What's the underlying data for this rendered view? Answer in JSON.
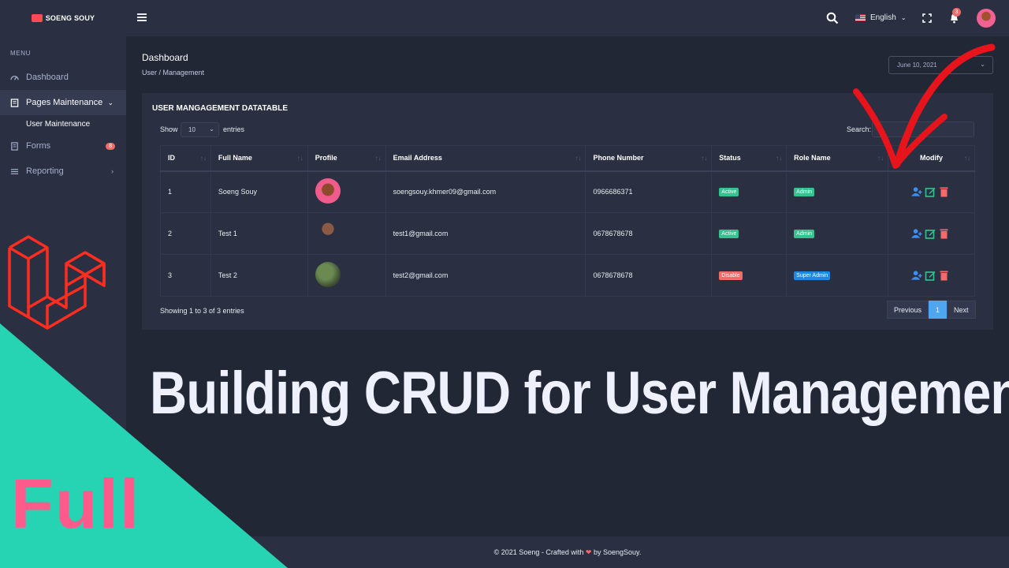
{
  "brand": {
    "name": "SOENG SOUY"
  },
  "sidebar": {
    "menu_title": "MENU",
    "items": [
      {
        "label": "Dashboard",
        "icon": "dashboard-icon"
      },
      {
        "label": "Pages Maintenance",
        "icon": "pages-icon",
        "active": true
      },
      {
        "label": "Forms",
        "icon": "forms-icon",
        "badge": "8"
      },
      {
        "label": "Reporting",
        "icon": "reporting-icon"
      }
    ],
    "submenu": {
      "label": "User Maintenance"
    }
  },
  "topbar": {
    "language": "English",
    "notification_count": "3"
  },
  "page": {
    "title": "Dashboard",
    "breadcrumb": "User / Management",
    "date_filter": "June 10, 2021"
  },
  "card": {
    "title": "USER MANGAGEMENT DATATABLE",
    "show_label": "Show",
    "show_value": "10",
    "entries_label": "entries",
    "search_label": "Search:",
    "columns": [
      "ID",
      "Full Name",
      "Profile",
      "Email Address",
      "Phone Number",
      "Status",
      "Role Name",
      "Modify"
    ],
    "rows": [
      {
        "id": "1",
        "name": "Soeng Souy",
        "email": "soengsouy.khmer09@gmail.com",
        "phone": "0966686371",
        "status": "Active",
        "role": "Admin"
      },
      {
        "id": "2",
        "name": "Test 1",
        "email": "test1@gmail.com",
        "phone": "0678678678",
        "status": "Active",
        "role": "Admin"
      },
      {
        "id": "3",
        "name": "Test 2",
        "email": "test2@gmail.com",
        "phone": "0678678678",
        "status": "Disable",
        "role": "Super Admin"
      }
    ],
    "showing": "Showing 1 to 3 of 3 entries",
    "pager": {
      "previous": "Previous",
      "page": "1",
      "next": "Next"
    }
  },
  "headline": "Building CRUD for User Management",
  "badge_text": "Full",
  "footer": {
    "prefix": "© 2021 Soeng - Crafted with",
    "suffix": "by SoengSouy."
  },
  "colors": {
    "accent_teal": "#26d4b4",
    "full_pink": "#ff5a8c",
    "laravel_red": "#ff2d20",
    "arrow_red": "#e8141b"
  }
}
